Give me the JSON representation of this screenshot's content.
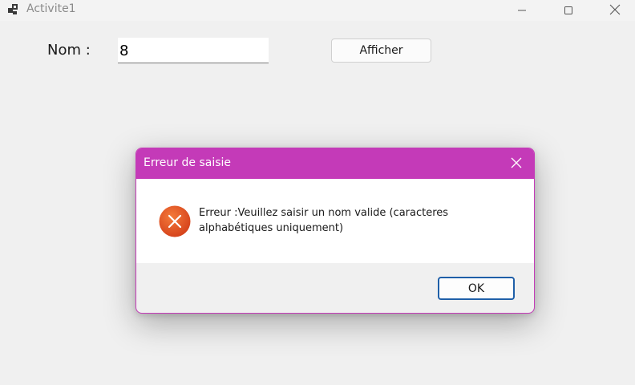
{
  "window": {
    "title": "Activite1",
    "icon": "app-window-icon",
    "controls": [
      "minimize-icon",
      "maximize-icon",
      "close-icon"
    ]
  },
  "form": {
    "name_label": "Nom :",
    "name_value": "8",
    "show_button": "Afficher"
  },
  "dialog": {
    "title": "Erreur de saisie",
    "icon": "error-icon",
    "message": "Erreur :Veuillez saisir un nom valide (caracteres alphabétiques uniquement)",
    "ok_button": "OK",
    "colors": {
      "titlebar": "#c43ab8",
      "error_icon": "#e0501e"
    }
  }
}
